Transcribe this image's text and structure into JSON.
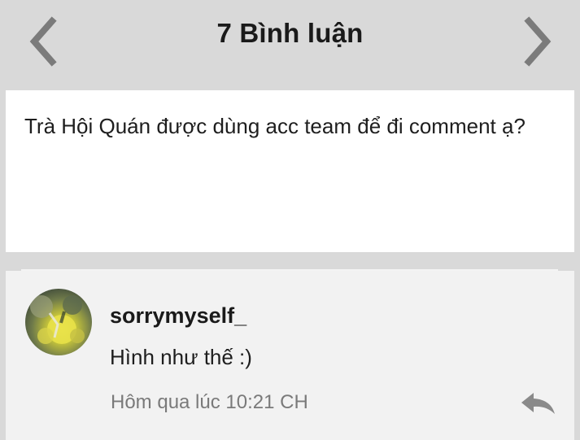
{
  "header": {
    "title": "7 Bình luận",
    "prev_icon": "chevron-left-icon",
    "next_icon": "chevron-right-icon"
  },
  "post": {
    "text": "Trà Hội Quán được dùng acc team để đi comment ạ?"
  },
  "comments": [
    {
      "author": "sorrymyself_",
      "text": "Hình như thế :)",
      "time": "Hôm qua lúc 10:21 CH",
      "avatar_icon": "avatar-image",
      "reply_icon": "reply-icon"
    }
  ],
  "colors": {
    "header_bg": "#d9d9d9",
    "card_bg": "#ffffff",
    "comment_bg": "#f2f2f2",
    "icon_gray": "#7b7b7b",
    "muted_text": "#7a7a7a"
  }
}
